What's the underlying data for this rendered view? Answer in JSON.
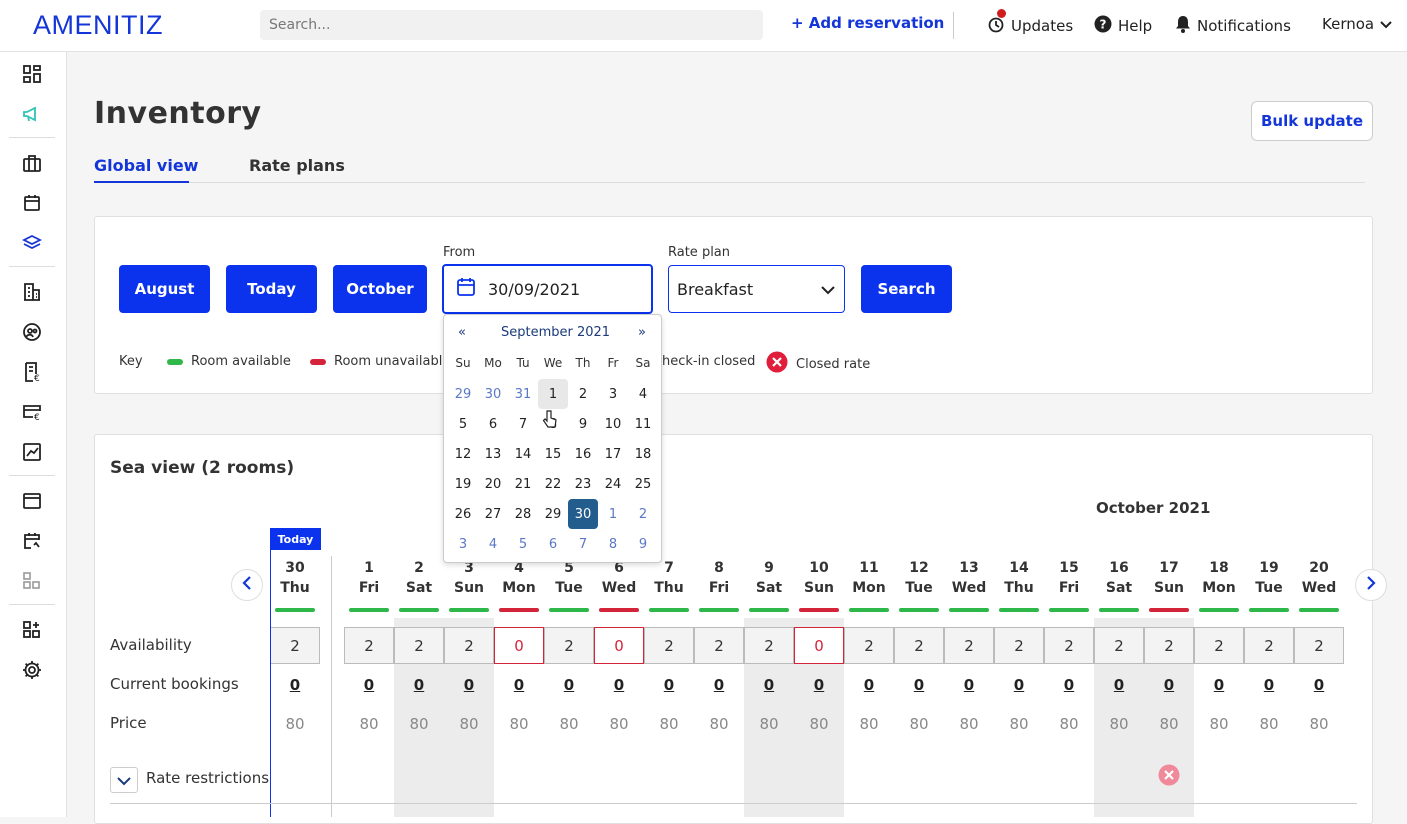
{
  "app": {
    "logo": "AMENITIZ",
    "search_placeholder": "Search...",
    "add_reservation": "+ Add reservation",
    "updates": "Updates",
    "help": "Help",
    "notifications": "Notifications",
    "user": "Kernoa"
  },
  "page": {
    "title": "Inventory",
    "bulk_update": "Bulk update",
    "tabs": [
      "Global view",
      "Rate plans"
    ]
  },
  "filters": {
    "btn_august": "August",
    "btn_today": "Today",
    "btn_october": "October",
    "from_label": "From",
    "from_value": "30/09/2021",
    "rate_plan_label": "Rate plan",
    "rate_plan_value": "Breakfast",
    "search": "Search",
    "key_label": "Key",
    "key_available": "Room available",
    "key_unavailable": "Room unavailable",
    "key_checkin": "heck-in closed",
    "key_closed_rate": "Closed rate",
    "colors": {
      "available": "#2fb84a",
      "unavailable": "#d4243a"
    }
  },
  "calendar": {
    "month": "September 2021",
    "prev": "«",
    "next": "»",
    "dow": [
      "Su",
      "Mo",
      "Tu",
      "We",
      "Th",
      "Fr",
      "Sa"
    ],
    "weeks": [
      [
        [
          "29",
          1
        ],
        [
          "30",
          1
        ],
        [
          "31",
          1
        ],
        [
          "1",
          0
        ],
        [
          "2",
          0
        ],
        [
          "3",
          0
        ],
        [
          "4",
          0
        ]
      ],
      [
        [
          "5",
          0
        ],
        [
          "6",
          0
        ],
        [
          "7",
          0
        ],
        [
          "8",
          0
        ],
        [
          "9",
          0
        ],
        [
          "10",
          0
        ],
        [
          "11",
          0
        ]
      ],
      [
        [
          "12",
          0
        ],
        [
          "13",
          0
        ],
        [
          "14",
          0
        ],
        [
          "15",
          0
        ],
        [
          "16",
          0
        ],
        [
          "17",
          0
        ],
        [
          "18",
          0
        ]
      ],
      [
        [
          "19",
          0
        ],
        [
          "20",
          0
        ],
        [
          "21",
          0
        ],
        [
          "22",
          0
        ],
        [
          "23",
          0
        ],
        [
          "24",
          0
        ],
        [
          "25",
          0
        ]
      ],
      [
        [
          "26",
          0
        ],
        [
          "27",
          0
        ],
        [
          "28",
          0
        ],
        [
          "29",
          0
        ],
        [
          "30",
          2
        ],
        [
          "1",
          1
        ],
        [
          "2",
          1
        ]
      ],
      [
        [
          "3",
          1
        ],
        [
          "4",
          1
        ],
        [
          "5",
          1
        ],
        [
          "6",
          1
        ],
        [
          "7",
          1
        ],
        [
          "8",
          1
        ],
        [
          "9",
          1
        ]
      ]
    ]
  },
  "grid": {
    "title": "Sea view (2 rooms)",
    "month_label": "October 2021",
    "today_tag": "Today",
    "row_labels": [
      "Availability",
      "Current bookings",
      "Price",
      "Rate restrictions"
    ],
    "days": [
      {
        "d": "30",
        "w": "Thu",
        "status": "available",
        "avail": "2",
        "book": "0",
        "price": "80"
      },
      {
        "d": "1",
        "w": "Fri",
        "status": "available",
        "avail": "2",
        "book": "0",
        "price": "80"
      },
      {
        "d": "2",
        "w": "Sat",
        "status": "available",
        "avail": "2",
        "book": "0",
        "price": "80"
      },
      {
        "d": "3",
        "w": "Sun",
        "status": "available",
        "avail": "2",
        "book": "0",
        "price": "80"
      },
      {
        "d": "4",
        "w": "Mon",
        "status": "unavailable",
        "avail": "0",
        "book": "0",
        "price": "80"
      },
      {
        "d": "5",
        "w": "Tue",
        "status": "available",
        "avail": "2",
        "book": "0",
        "price": "80"
      },
      {
        "d": "6",
        "w": "Wed",
        "status": "unavailable",
        "avail": "0",
        "book": "0",
        "price": "80"
      },
      {
        "d": "7",
        "w": "Thu",
        "status": "available",
        "avail": "2",
        "book": "0",
        "price": "80"
      },
      {
        "d": "8",
        "w": "Fri",
        "status": "available",
        "avail": "2",
        "book": "0",
        "price": "80"
      },
      {
        "d": "9",
        "w": "Sat",
        "status": "available",
        "avail": "2",
        "book": "0",
        "price": "80"
      },
      {
        "d": "10",
        "w": "Sun",
        "status": "unavailable",
        "avail": "0",
        "book": "0",
        "price": "80"
      },
      {
        "d": "11",
        "w": "Mon",
        "status": "available",
        "avail": "2",
        "book": "0",
        "price": "80"
      },
      {
        "d": "12",
        "w": "Tue",
        "status": "available",
        "avail": "2",
        "book": "0",
        "price": "80"
      },
      {
        "d": "13",
        "w": "Wed",
        "status": "available",
        "avail": "2",
        "book": "0",
        "price": "80"
      },
      {
        "d": "14",
        "w": "Thu",
        "status": "available",
        "avail": "2",
        "book": "0",
        "price": "80"
      },
      {
        "d": "15",
        "w": "Fri",
        "status": "available",
        "avail": "2",
        "book": "0",
        "price": "80"
      },
      {
        "d": "16",
        "w": "Sat",
        "status": "available",
        "avail": "2",
        "book": "0",
        "price": "80"
      },
      {
        "d": "17",
        "w": "Sun",
        "status": "unavailable",
        "avail": "2",
        "book": "0",
        "price": "80",
        "closed_rate": true
      },
      {
        "d": "18",
        "w": "Mon",
        "status": "available",
        "avail": "2",
        "book": "0",
        "price": "80"
      },
      {
        "d": "19",
        "w": "Tue",
        "status": "available",
        "avail": "2",
        "book": "0",
        "price": "80"
      },
      {
        "d": "20",
        "w": "Wed",
        "status": "available",
        "avail": "2",
        "book": "0",
        "price": "80"
      }
    ]
  }
}
